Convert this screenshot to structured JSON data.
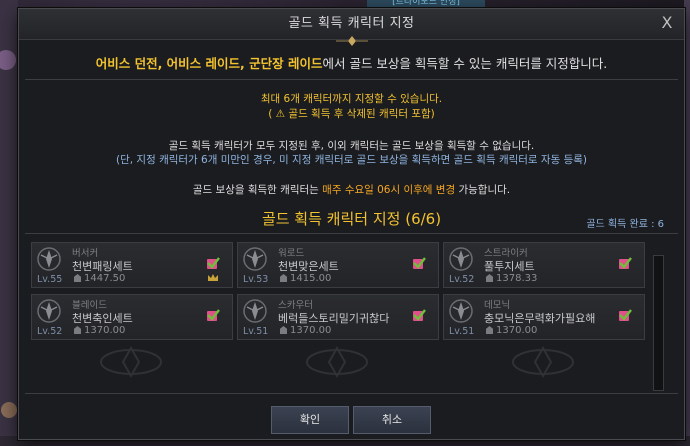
{
  "banner_text": "[트라이포드 안정]",
  "window": {
    "title": "골드 획득 캐릭터 지정",
    "close_glyph": "X"
  },
  "intro": {
    "gold_part": "어비스 던전, 어비스 레이드, 군단장 레이드",
    "rest": "에서 골드 보상을 획득할 수 있는 캐릭터를 지정합니다."
  },
  "notes": {
    "max_line": "최대 6개 캐릭터까지 지정할 수 있습니다.",
    "warning_line": "( ⚠ 골드 획득 후 삭제된 캐릭터 포함)",
    "all_set_line": "골드 획득 캐릭터가 모두 지정된 후, 이외 캐릭터는 골드 보상을 획득할 수 없습니다.",
    "auto_line": "(단, 지정 캐릭터가 6개 미만인 경우, 미 지정 캐릭터로 골드 보상을 획득하면 골드 획득 캐릭터로 자동 등록)",
    "change_prefix": "골드 보상을 획득한 캐릭터는 ",
    "change_highlight": "매주 수요일 06시 이후에 변경",
    "change_suffix": " 가능합니다."
  },
  "section": {
    "title": "골드 획득 캐릭터 지정 (6/6)",
    "complete_label": "골드 획득 완료 : 6"
  },
  "characters": [
    {
      "class": "버서커",
      "name": "천변패링세트",
      "level": "Lv.55",
      "item_level": "1447.50",
      "crown": true,
      "icon": "berserker-class-icon"
    },
    {
      "class": "워로드",
      "name": "천변맞은세트",
      "level": "Lv.53",
      "item_level": "1415.00",
      "crown": false,
      "icon": "warlord-class-icon"
    },
    {
      "class": "스트라이커",
      "name": "풀투지세트",
      "level": "Lv.52",
      "item_level": "1378.33",
      "crown": false,
      "icon": "striker-class-icon"
    },
    {
      "class": "블레이드",
      "name": "천변축인세트",
      "level": "Lv.52",
      "item_level": "1370.00",
      "crown": false,
      "icon": "blade-class-icon"
    },
    {
      "class": "스카우터",
      "name": "베럭들스토리밀기귀찮다",
      "level": "Lv.51",
      "item_level": "1370.00",
      "crown": false,
      "icon": "scouter-class-icon"
    },
    {
      "class": "데모닉",
      "name": "충모닉은무력화가필요해",
      "level": "Lv.51",
      "item_level": "1370.00",
      "crown": false,
      "icon": "demonic-class-icon"
    }
  ],
  "buttons": {
    "confirm": "확인",
    "cancel": "취소"
  },
  "colors": {
    "gold": "#f2c230",
    "note_blue": "#8fb4e0",
    "check_green": "#6fbf3a",
    "check_pink": "#e0508a"
  }
}
